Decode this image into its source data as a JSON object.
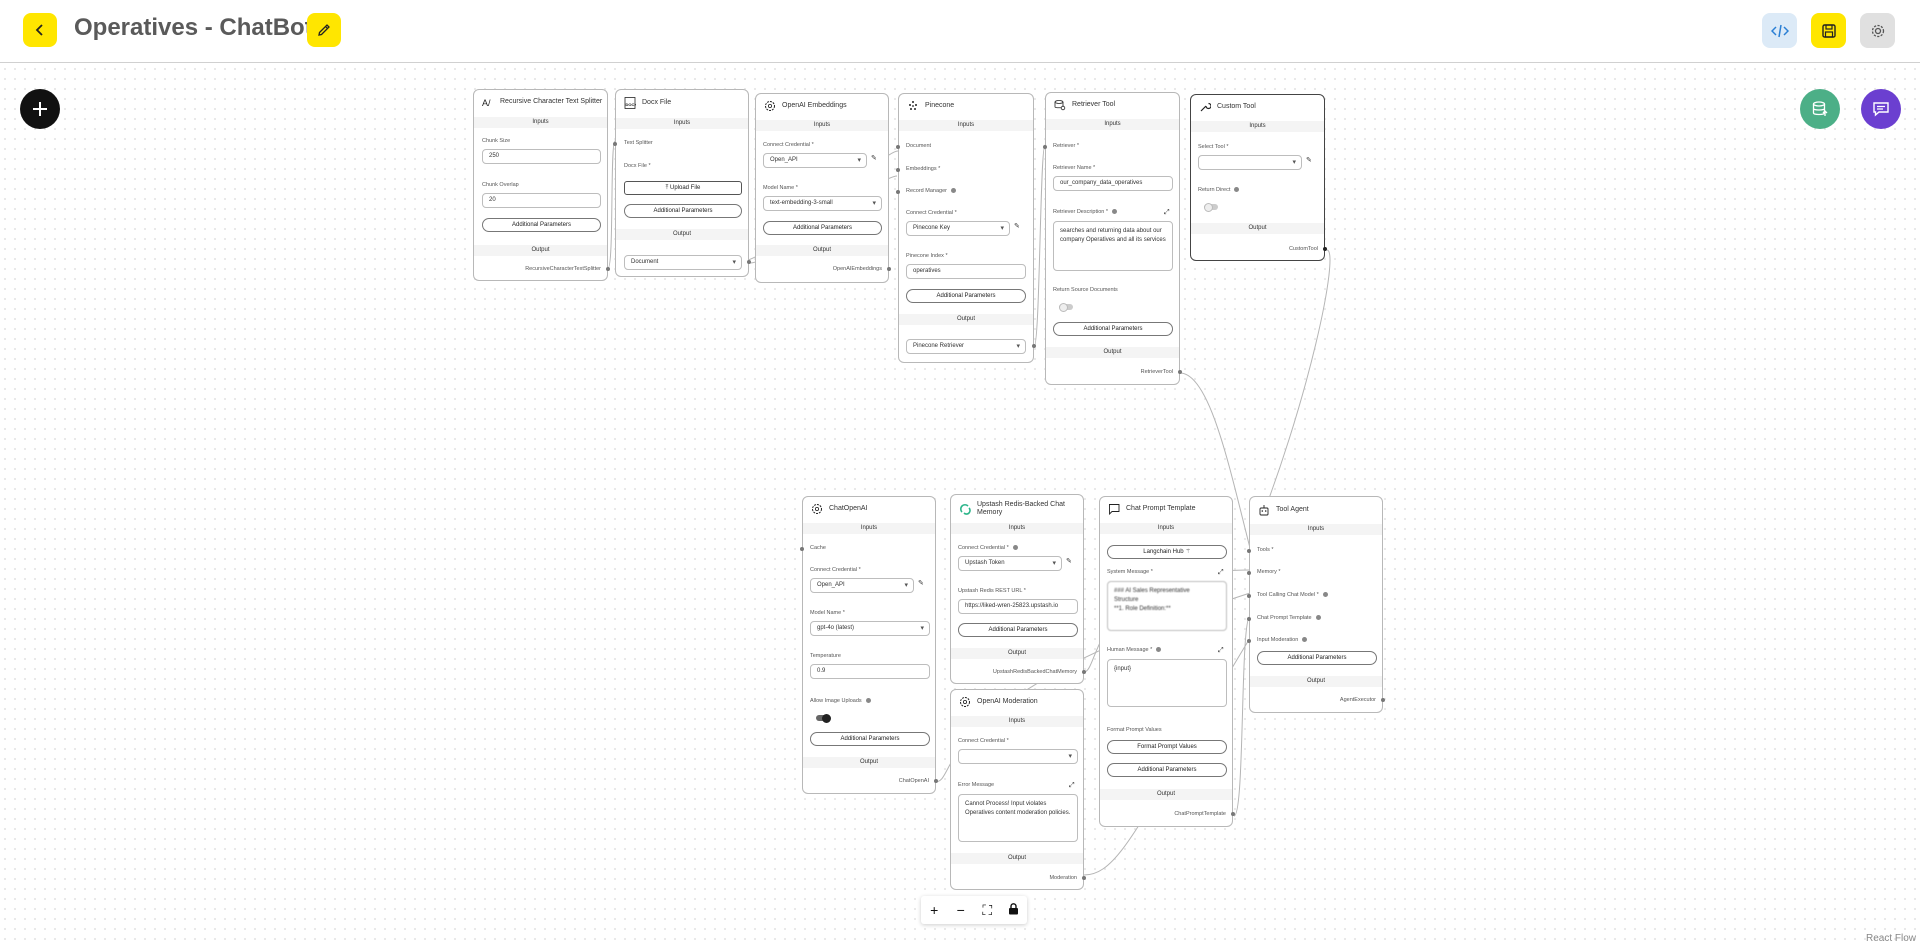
{
  "header": {
    "title": "Operatives - ChatBot"
  },
  "nodes": {
    "splitter": {
      "title": "Recursive Character Text Splitter",
      "inputs": "Inputs",
      "chunk_size_label": "Chunk Size",
      "chunk_size": "250",
      "chunk_overlap_label": "Chunk Overlap",
      "chunk_overlap": "20",
      "additional": "Additional Parameters",
      "output": "Output",
      "output_name": "RecursiveCharacterTextSplitter"
    },
    "docx": {
      "title": "Docx File",
      "inputs": "Inputs",
      "text_splitter": "Text Splitter",
      "docx_label": "Docx File *",
      "upload": "Upload File",
      "additional": "Additional Parameters",
      "output": "Output",
      "output_value": "Document"
    },
    "embeddings": {
      "title": "OpenAI Embeddings",
      "inputs": "Inputs",
      "cred_label": "Connect Credential *",
      "cred": "Open_API",
      "model_label": "Model Name *",
      "model": "text-embedding-3-small",
      "additional": "Additional Parameters",
      "output": "Output",
      "output_name": "OpenAIEmbeddings"
    },
    "pinecone": {
      "title": "Pinecone",
      "inputs": "Inputs",
      "document": "Document",
      "embeddings": "Embeddings *",
      "record_manager": "Record Manager",
      "cred_label": "Connect Credential *",
      "cred": "Pinecone Key",
      "index_label": "Pinecone Index *",
      "index": "operatives",
      "additional": "Additional Parameters",
      "output": "Output",
      "output_value": "Pinecone Retriever"
    },
    "retriever": {
      "title": "Retriever Tool",
      "inputs": "Inputs",
      "retriever": "Retriever *",
      "name_label": "Retriever Name *",
      "name": "our_company_data_operatives",
      "desc_label": "Retriever Description *",
      "desc": "searches and returning data about our company Operatives and all its services",
      "return_src": "Return Source Documents",
      "additional": "Additional Parameters",
      "output": "Output",
      "output_name": "RetrieverTool"
    },
    "custom": {
      "title": "Custom Tool",
      "inputs": "Inputs",
      "select_label": "Select Tool *",
      "return_direct": "Return Direct",
      "output": "Output",
      "output_name": "CustomTool"
    },
    "chatopenai": {
      "title": "ChatOpenAI",
      "inputs": "Inputs",
      "cache": "Cache",
      "cred_label": "Connect Credential *",
      "cred": "Open_API",
      "model_label": "Model Name *",
      "model": "gpt-4o (latest)",
      "temp_label": "Temperature",
      "temp": "0.9",
      "uploads_label": "Allow Image Uploads",
      "additional": "Additional Parameters",
      "output": "Output",
      "output_name": "ChatOpenAI"
    },
    "upstash": {
      "title": "Upstash Redis-Backed Chat Memory",
      "inputs": "Inputs",
      "cred_label": "Connect Credential *",
      "cred": "Upstash Token",
      "url_label": "Upstash Redis REST URL *",
      "url": "https://liked-wren-25823.upstash.io",
      "additional": "Additional Parameters",
      "output": "Output",
      "output_name": "UpstashRedisBackedChatMemory"
    },
    "moderation": {
      "title": "OpenAI Moderation",
      "inputs": "Inputs",
      "cred_label": "Connect Credential *",
      "error_label": "Error Message",
      "error": "Cannot Process! Input violates Operatives content moderation policies.",
      "output": "Output",
      "output_name": "Moderation"
    },
    "prompt": {
      "title": "Chat Prompt Template",
      "inputs": "Inputs",
      "hub": "Langchain Hub",
      "system_label": "System Message *",
      "system_line1": "### AI Sales Representative",
      "system_line2": "Structure",
      "system_line3": "**1. Role Definition:**",
      "human_label": "Human Message *",
      "human": "{input}",
      "format_label": "Format Prompt Values",
      "format_btn": "Format Prompt Values",
      "additional": "Additional Parameters",
      "output": "Output",
      "output_name": "ChatPromptTemplate"
    },
    "agent": {
      "title": "Tool Agent",
      "inputs": "Inputs",
      "tools": "Tools *",
      "memory": "Memory *",
      "model": "Tool Calling Chat Model *",
      "prompt": "Chat Prompt Template",
      "moderation": "Input Moderation",
      "additional": "Additional Parameters",
      "output": "Output",
      "output_name": "AgentExecutor"
    }
  },
  "zoom_controls": {
    "zoom_in": "+",
    "zoom_out": "−",
    "fit": "⛶"
  },
  "attribution": "React Flow",
  "colors": {
    "accent_yellow": "#ffe600",
    "db_green": "#4caf87",
    "chat_purple": "#6b3fd0",
    "code_blue": "#dceaf7"
  }
}
